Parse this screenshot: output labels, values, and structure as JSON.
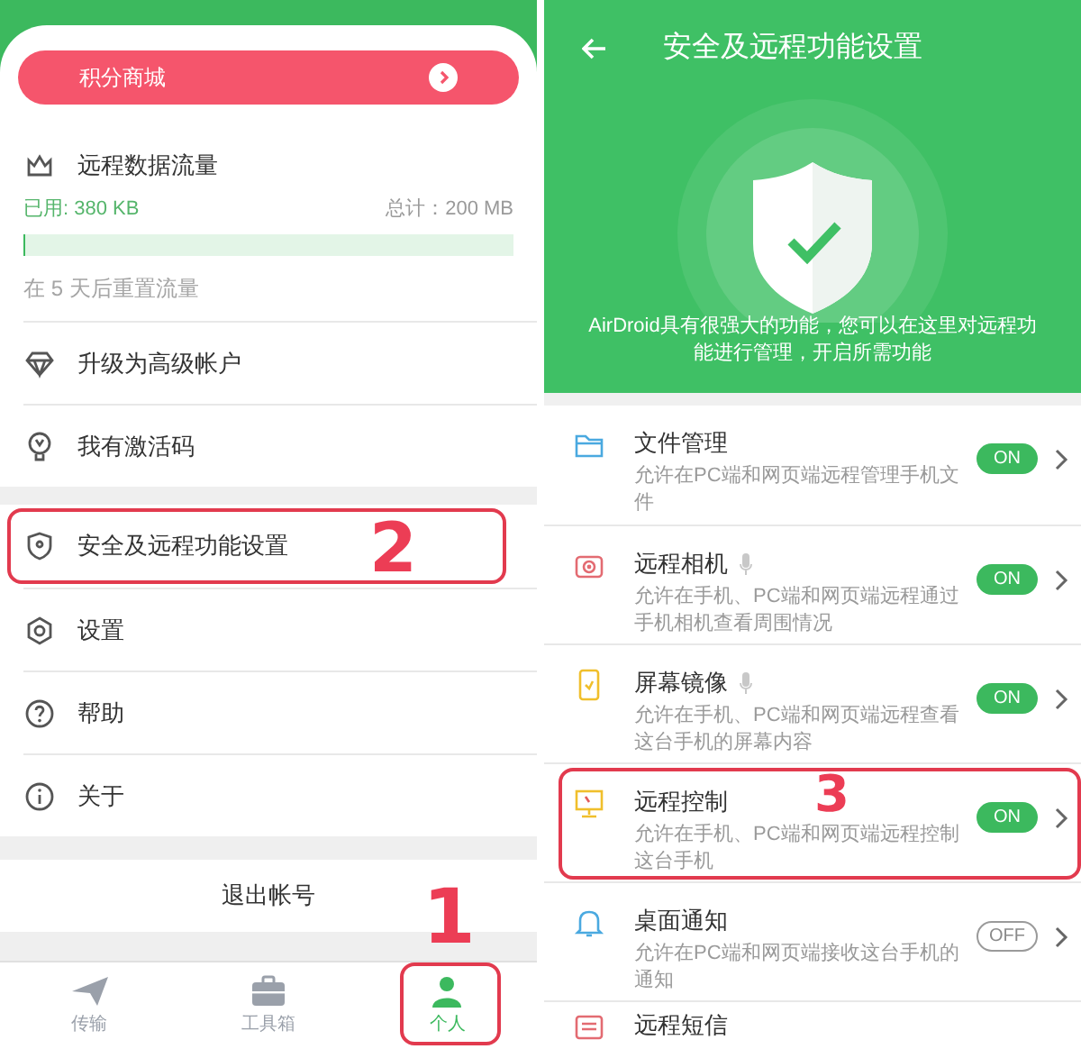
{
  "left_panel": {
    "banner": {
      "label": "积分商城"
    },
    "traffic": {
      "title": "远程数据流量",
      "used": "已用: 380 KB",
      "total": "总计：200 MB",
      "level": 0.002,
      "reset_note": "在 5 天后重置流量"
    },
    "account_items": [
      {
        "label": "升级为高级帐户"
      },
      {
        "label": "我有激活码"
      }
    ],
    "menu_items": [
      {
        "label": "安全及远程功能设置",
        "annotation": "2"
      },
      {
        "label": "设置"
      },
      {
        "label": "帮助"
      },
      {
        "label": "关于"
      }
    ],
    "logout": "退出帐号",
    "tabs": [
      {
        "label": "传输",
        "selected": false
      },
      {
        "label": "工具箱",
        "selected": false
      },
      {
        "label": "个人",
        "selected": true,
        "annotation": "1"
      }
    ]
  },
  "right_panel": {
    "title": "安全及远程功能设置",
    "description": "AirDroid具有很强大的功能，您可以在这里对远程功能进行管理，开启所需功能",
    "features": [
      {
        "title": "文件管理",
        "mic": false,
        "description": "允许在PC端和网页端远程管理手机文件",
        "on": true,
        "toggle_label": "ON"
      },
      {
        "title": "远程相机",
        "mic": true,
        "description": "允许在手机、PC端和网页端远程通过手机相机查看周围情况",
        "on": true,
        "toggle_label": "ON"
      },
      {
        "title": "屏幕镜像",
        "mic": true,
        "description": "允许在手机、PC端和网页端远程查看这台手机的屏幕内容",
        "on": true,
        "toggle_label": "ON"
      },
      {
        "title": "远程控制",
        "mic": false,
        "description": "允许在手机、PC端和网页端远程控制这台手机",
        "on": true,
        "toggle_label": "ON",
        "annotation": "3"
      },
      {
        "title": "桌面通知",
        "mic": false,
        "description": "允许在PC端和网页端接收这台手机的通知",
        "on": false,
        "toggle_label": "OFF"
      },
      {
        "title": "远程短信",
        "mic": false
      }
    ]
  }
}
